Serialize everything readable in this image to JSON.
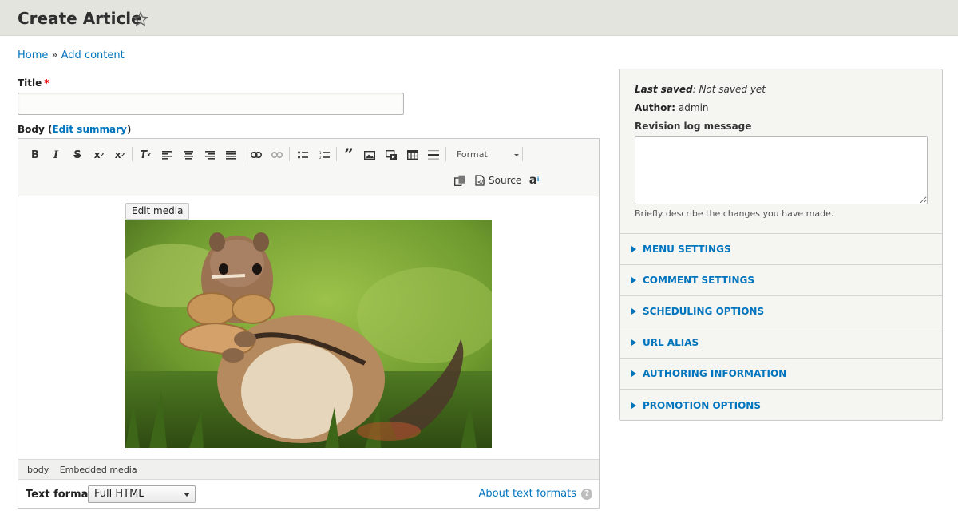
{
  "header": {
    "title": "Create Article"
  },
  "breadcrumb": {
    "home": "Home",
    "separator": "»",
    "current": "Add content"
  },
  "form": {
    "title_label": "Title",
    "title_value": "",
    "body_label": "Body",
    "edit_summary": "Edit summary",
    "toolbar": {
      "format_combo": "Format",
      "source_label": "Source"
    },
    "edit_media_label": "Edit media",
    "elements_path": [
      "body",
      "Embedded media"
    ],
    "text_format_label": "Text format",
    "text_format_value": "Full HTML",
    "about_formats": "About text formats"
  },
  "sidebar": {
    "last_saved_label": "Last saved",
    "last_saved_value": "Not saved yet",
    "author_label": "Author",
    "author_value": "admin",
    "revision_label": "Revision log message",
    "revision_description": "Briefly describe the changes you have made.",
    "sections": [
      "MENU SETTINGS",
      "COMMENT SETTINGS",
      "SCHEDULING OPTIONS",
      "URL ALIAS",
      "AUTHORING INFORMATION",
      "PROMOTION OPTIONS"
    ]
  },
  "colors": {
    "link": "#0074bd",
    "header_bg": "#e4e4de",
    "required": "#e00000"
  }
}
